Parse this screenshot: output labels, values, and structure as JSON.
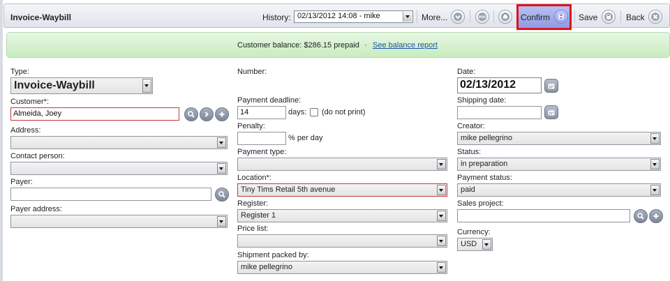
{
  "toolbar": {
    "title": "Invoice-Waybill",
    "history_label": "History:",
    "history_value": "02/13/2012 14:08 - mike",
    "more_label": "More...",
    "confirm_label": "Confirm",
    "save_label": "Save",
    "back_label": "Back"
  },
  "banner": {
    "balance_text": "Customer balance: $286.15 prepaid",
    "separator": "·",
    "report_link": "See balance report"
  },
  "left": {
    "type_label": "Type:",
    "type_value": "Invoice-Waybill",
    "customer_label": "Customer*:",
    "customer_value": "Almeida, Joey",
    "address_label": "Address:",
    "address_value": "",
    "contact_label": "Contact person:",
    "contact_value": "",
    "payer_label": "Payer:",
    "payer_value": "",
    "payer_address_label": "Payer address:",
    "payer_address_value": ""
  },
  "middle": {
    "number_label": "Number:",
    "deadline_label": "Payment deadline:",
    "deadline_value": "14",
    "days_label": "days:",
    "do_not_print_label": "(do not print)",
    "penalty_label": "Penalty:",
    "penalty_value": "",
    "per_day_label": "% per day",
    "payment_type_label": "Payment type:",
    "payment_type_value": "",
    "location_label": "Location*:",
    "location_value": "Tiny Tims Retail 5th avenue",
    "register_label": "Register:",
    "register_value": "Register 1",
    "price_list_label": "Price list:",
    "price_list_value": "",
    "packed_by_label": "Shipment packed by:",
    "packed_by_value": "mike pellegrino"
  },
  "right": {
    "date_label": "Date:",
    "date_value": "02/13/2012",
    "shipping_label": "Shipping date:",
    "shipping_value": "",
    "creator_label": "Creator:",
    "creator_value": "mike pellegrino",
    "status_label": "Status:",
    "status_value": "in preparation",
    "payment_status_label": "Payment status:",
    "payment_status_value": "paid",
    "sales_project_label": "Sales project:",
    "sales_project_value": "",
    "currency_label": "Currency:",
    "currency_value": "USD"
  },
  "icons": {
    "more": "chevron-down-icon",
    "pdf": "pdf-icon",
    "print": "print-icon",
    "confirm": "save-icon",
    "save": "save-icon",
    "back": "close-icon",
    "search": "search-icon",
    "forward": "arrow-right-icon",
    "add": "plus-icon",
    "calendar": "calendar-icon"
  },
  "colors": {
    "confirm_highlight": "#e0121a",
    "banner_bg": "#d3efcb",
    "link": "#1c54a8",
    "required_border": "#c03a3a"
  }
}
